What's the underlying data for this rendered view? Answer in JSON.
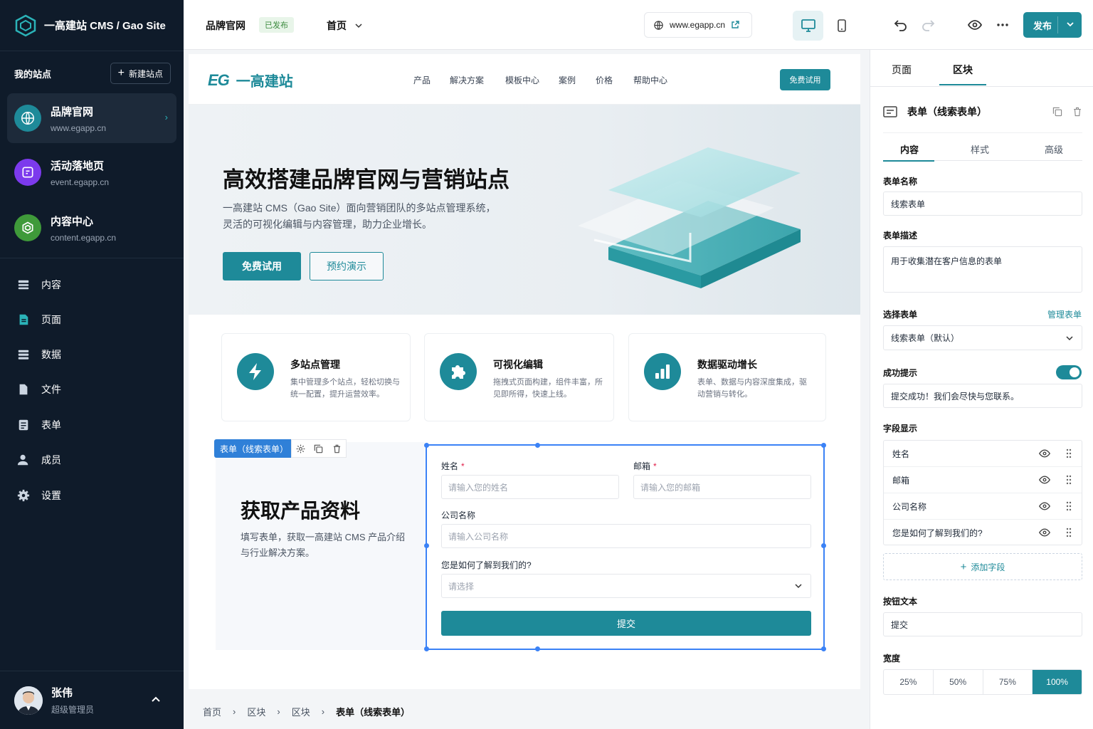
{
  "app": {
    "title": "一高建站 CMS / Gao Site"
  },
  "sidebar": {
    "my_sites_label": "我的站点",
    "new_site_label": "新建站点",
    "sites": [
      {
        "name": "品牌官网",
        "url": "www.egapp.cn",
        "color": "#1e8a99",
        "icon": "globe-icon"
      },
      {
        "name": "活动落地页",
        "url": "event.egapp.cn",
        "color": "#7c3aed",
        "icon": "landing-page-icon"
      },
      {
        "name": "内容中心",
        "url": "content.egapp.cn",
        "color": "#3f9a3a",
        "icon": "content-hub-icon"
      }
    ],
    "nav": [
      {
        "label": "内容",
        "icon": "content-icon"
      },
      {
        "label": "页面",
        "icon": "page-icon"
      },
      {
        "label": "数据",
        "icon": "data-icon"
      },
      {
        "label": "文件",
        "icon": "file-icon"
      },
      {
        "label": "表单",
        "icon": "form-icon"
      },
      {
        "label": "成员",
        "icon": "members-icon"
      },
      {
        "label": "设置",
        "icon": "gear-icon"
      }
    ],
    "user": {
      "name": "张伟",
      "role": "超级管理员"
    }
  },
  "topbar": {
    "site_name": "品牌官网",
    "status_badge": "已发布",
    "page_select": "首页",
    "url": "www.egapp.cn",
    "publish_label": "发布"
  },
  "canvas": {
    "logo_text": "一高建站",
    "logo_mark": "EG",
    "nav_items": [
      "产品",
      "解决方案",
      "模板中心",
      "案例",
      "价格",
      "帮助中心"
    ],
    "cta": "免费试用",
    "hero": {
      "title": "高效搭建品牌官网与营销站点",
      "desc_line1": "一高建站 CMS（Gao Site）面向营销团队的多站点管理系统，",
      "desc_line2": "灵活的可视化编辑与内容管理，助力企业增长。",
      "btn_primary": "免费试用",
      "btn_secondary": "预约演示"
    },
    "features": [
      {
        "title": "多站点管理",
        "desc": "集中管理多个站点，轻松切换与统一配置，提升运营效率。",
        "icon": "lightning-icon"
      },
      {
        "title": "可视化编辑",
        "desc": "拖拽式页面构建，组件丰富，所见即所得，快速上线。",
        "icon": "puzzle-icon"
      },
      {
        "title": "数据驱动增长",
        "desc": "表单、数据与内容深度集成，驱动营销与转化。",
        "icon": "bar-chart-icon"
      }
    ],
    "form_section": {
      "block_label": "表单（线索表单）",
      "title": "获取产品资料",
      "desc": "填写表单，获取一高建站 CMS 产品介绍与行业解决方案。",
      "fields": {
        "name_label": "姓名",
        "name_placeholder": "请输入您的姓名",
        "email_label": "邮箱",
        "email_placeholder": "请输入您的邮箱",
        "company_label": "公司名称",
        "company_placeholder": "请输入公司名称",
        "source_label": "您是如何了解到我们的?",
        "source_placeholder": "请选择"
      },
      "submit": "提交"
    }
  },
  "breadcrumb": [
    "首页",
    "区块",
    "区块",
    "表单（线索表单）"
  ],
  "panel": {
    "tabs": [
      "页面",
      "区块"
    ],
    "active_tab": "区块",
    "block_title": "表单（线索表单）",
    "subtabs": [
      "内容",
      "样式",
      "高级"
    ],
    "form_name_label": "表单名称",
    "form_name_value": "线索表单",
    "form_desc_label": "表单描述",
    "form_desc_value": "用于收集潜在客户信息的表单",
    "select_form_label": "选择表单",
    "manage_form_link": "管理表单",
    "select_form_value": "线索表单（默认）",
    "success_label": "成功提示",
    "success_value": "提交成功！我们会尽快与您联系。",
    "fields_label": "字段显示",
    "fields": [
      "姓名",
      "邮箱",
      "公司名称",
      "您是如何了解到我们的?"
    ],
    "add_field": "添加字段",
    "button_text_label": "按钮文本",
    "button_text_value": "提交",
    "width_label": "宽度",
    "widths": [
      "25%",
      "50%",
      "75%",
      "100%"
    ],
    "width_selected": "100%"
  },
  "colors": {
    "accent": "#1e8a99",
    "sidebar_bg": "#0f1b2a",
    "selection": "#3b82f6"
  }
}
